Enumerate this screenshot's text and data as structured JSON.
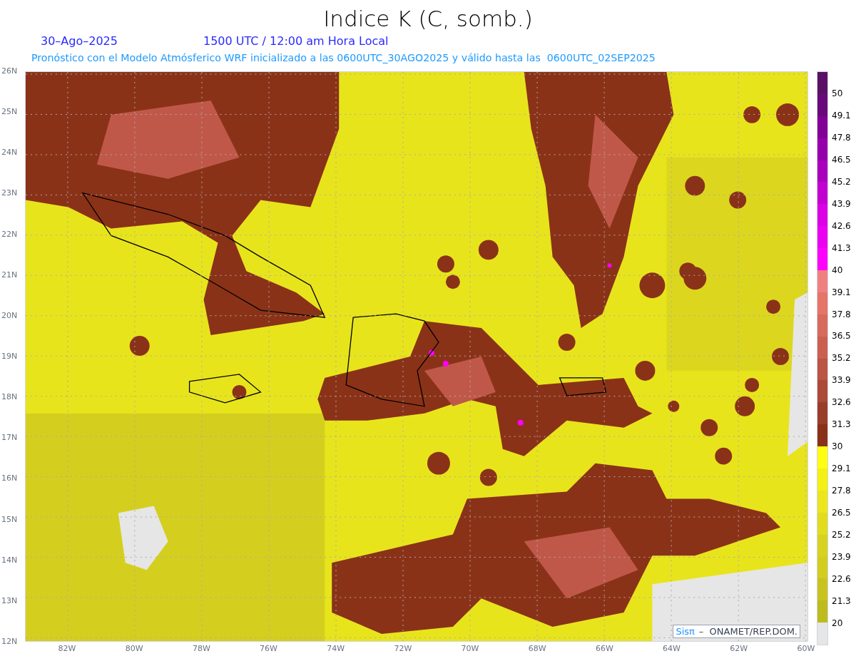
{
  "title": "Indice K (C, somb.)",
  "date": "30–Ago–2025",
  "time": "1500 UTC / 12:00 am Hora Local",
  "subtitle": "Pronóstico con el Modelo Atmósferico WRF inicializado a las 0600UTC_30AGO2025 y válido hasta las  0600UTC_02SEP2025",
  "lat_labels": [
    "26N",
    "25N",
    "24N",
    "23N",
    "22N",
    "21N",
    "20N",
    "19N",
    "18N",
    "17N",
    "16N",
    "15N",
    "14N",
    "13N",
    "12N"
  ],
  "lon_labels": [
    "82W",
    "80W",
    "78W",
    "76W",
    "74W",
    "72W",
    "70W",
    "68W",
    "66W",
    "64W",
    "62W",
    "60W"
  ],
  "credit": {
    "brand": "Sisπ",
    "text": "–  ONAMET/REP.DOM."
  },
  "colorbar": {
    "bins": [
      {
        "color": "#5a1066"
      },
      {
        "color": "#6a0a7a"
      },
      {
        "color": "#820096"
      },
      {
        "color": "#9600aa"
      },
      {
        "color": "#aa00be"
      },
      {
        "color": "#c300d2"
      },
      {
        "color": "#dc00e6"
      },
      {
        "color": "#eb00f0"
      },
      {
        "color": "#ff00ff"
      },
      {
        "color": "#f08080"
      },
      {
        "color": "#e67468"
      },
      {
        "color": "#d86a5c"
      },
      {
        "color": "#cc6050"
      },
      {
        "color": "#bc5444"
      },
      {
        "color": "#ac4a38"
      },
      {
        "color": "#9a3e2c"
      },
      {
        "color": "#8a3218"
      },
      {
        "color": "#ffff14"
      },
      {
        "color": "#f5f014"
      },
      {
        "color": "#ebe61e"
      },
      {
        "color": "#e1dc1e"
      },
      {
        "color": "#d7d21e"
      },
      {
        "color": "#d2cd1e"
      },
      {
        "color": "#c8c31e"
      },
      {
        "color": "#bebb1e"
      },
      {
        "color": "#e6e6e6"
      }
    ],
    "labels": [
      "50",
      "49.1",
      "47.8",
      "46.5",
      "45.2",
      "43.9",
      "42.6",
      "41.3",
      "40",
      "39.1",
      "37.8",
      "36.5",
      "35.2",
      "33.9",
      "32.6",
      "31.3",
      "30",
      "29.1",
      "27.8",
      "26.5",
      "25.2",
      "23.9",
      "22.6",
      "21.3",
      "20"
    ]
  }
}
